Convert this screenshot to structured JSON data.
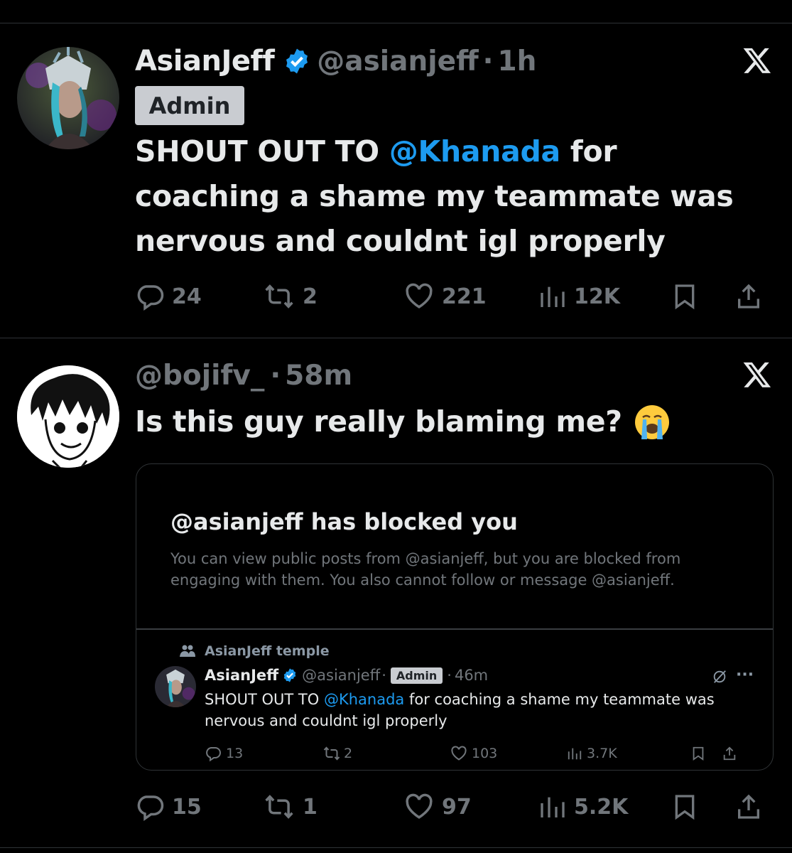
{
  "posts": [
    {
      "name": "AsianJeff",
      "handle": "@asianjeff",
      "time": "1h",
      "badge": "Admin",
      "text_before": "SHOUT OUT TO ",
      "mention": "@Khanada",
      "text_line1_after": " for",
      "text_line2": "coaching a shame my teammate was",
      "text_line3": "nervous and couldnt igl properly",
      "replies": "24",
      "reposts": "2",
      "likes": "221",
      "views": "12K"
    },
    {
      "handle": "@bojifv_",
      "time": "58m",
      "text": "Is this guy really blaming me?",
      "emoji": "😭",
      "replies": "15",
      "reposts": "1",
      "likes": "97",
      "views": "5.2K"
    }
  ],
  "quote": {
    "blocked_title": "@asianjeff has blocked you",
    "blocked_desc": "You can view public posts from @asianjeff, but you are blocked from engaging with them. You also cannot follow or message @asianjeff.",
    "community": "AsianJeff temple",
    "name": "AsianJeff",
    "handle": "@asianjeff",
    "badge": "Admin",
    "time": "46m",
    "text_before": "SHOUT OUT TO ",
    "mention": "@Khanada",
    "text_after": " for coaching a shame my teammate was nervous and couldnt igl properly",
    "replies": "13",
    "reposts": "2",
    "likes": "103",
    "views": "3.7K"
  },
  "colors": {
    "accent": "#1d9bf0",
    "muted": "#71767b",
    "text": "#e7e9ea",
    "background": "#000000"
  },
  "icons": [
    "x-logo-icon",
    "verified-badge-icon",
    "reply-icon",
    "repost-icon",
    "like-icon",
    "views-icon",
    "bookmark-icon",
    "share-icon",
    "community-icon",
    "grok-icon",
    "more-icon"
  ]
}
